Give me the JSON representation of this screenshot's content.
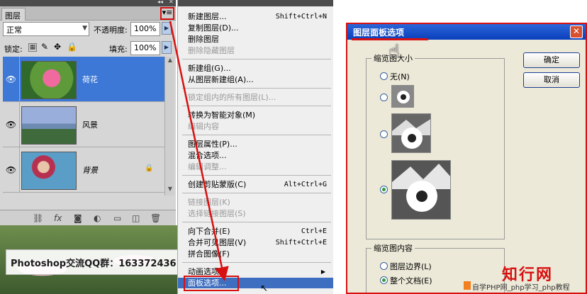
{
  "layers_panel": {
    "tab_label": "图层",
    "blend_mode": "正常",
    "opacity_label": "不透明度:",
    "opacity_value": "100%",
    "lock_label": "锁定:",
    "fill_label": "填充:",
    "fill_value": "100%",
    "layers": [
      {
        "name": "荷花",
        "selected": true
      },
      {
        "name": "风景",
        "selected": false
      },
      {
        "name": "背景",
        "selected": false
      }
    ]
  },
  "qq_banner": "Photoshop交流QQ群：163372436",
  "context_menu": {
    "items": [
      {
        "label": "新建图层...",
        "shortcut": "Shift+Ctrl+N",
        "disabled": false
      },
      {
        "label": "复制图层(D)...",
        "shortcut": "",
        "disabled": false
      },
      {
        "label": "删除图层",
        "shortcut": "",
        "disabled": false
      },
      {
        "label": "删除隐藏图层",
        "shortcut": "",
        "disabled": true
      },
      {
        "label": "新建组(G)...",
        "shortcut": "",
        "disabled": false
      },
      {
        "label": "从图层新建组(A)...",
        "shortcut": "",
        "disabled": false
      },
      {
        "label": "锁定组内的所有图层(L)...",
        "shortcut": "",
        "disabled": true
      },
      {
        "label": "转换为智能对象(M)",
        "shortcut": "",
        "disabled": false
      },
      {
        "label": "编辑内容",
        "shortcut": "",
        "disabled": true
      },
      {
        "label": "图层属性(P)...",
        "shortcut": "",
        "disabled": false
      },
      {
        "label": "混合选项...",
        "shortcut": "",
        "disabled": false
      },
      {
        "label": "编辑调整...",
        "shortcut": "",
        "disabled": true
      },
      {
        "label": "创建剪贴蒙版(C)",
        "shortcut": "Alt+Ctrl+G",
        "disabled": false
      },
      {
        "label": "链接图层(K)",
        "shortcut": "",
        "disabled": true
      },
      {
        "label": "选择链接图层(S)",
        "shortcut": "",
        "disabled": true
      },
      {
        "label": "向下合并(E)",
        "shortcut": "Ctrl+E",
        "disabled": false
      },
      {
        "label": "合并可见图层(V)",
        "shortcut": "Shift+Ctrl+E",
        "disabled": false
      },
      {
        "label": "拼合图像(F)",
        "shortcut": "",
        "disabled": false
      },
      {
        "label": "动画选项",
        "shortcut": "",
        "disabled": false
      },
      {
        "label": "面板选项...",
        "shortcut": "",
        "disabled": false
      }
    ]
  },
  "dialog": {
    "title": "图层面板选项",
    "group_thumb_size": "缩览图大小",
    "option_none": "无(N)",
    "group_thumb_content": "缩览图内容",
    "option_layer_bounds": "图层边界(L)",
    "option_entire_doc": "整个文档(E)",
    "ok_label": "确定",
    "cancel_label": "取消"
  },
  "watermark": {
    "brand": "知行网",
    "tagline": "自学PHP网_php学习_php教程"
  },
  "colors": {
    "highlight_red": "#d81010",
    "selection_blue": "#3d78d6",
    "menu_hover": "#3d6ec0",
    "xp_title": "#0a3fbb"
  }
}
